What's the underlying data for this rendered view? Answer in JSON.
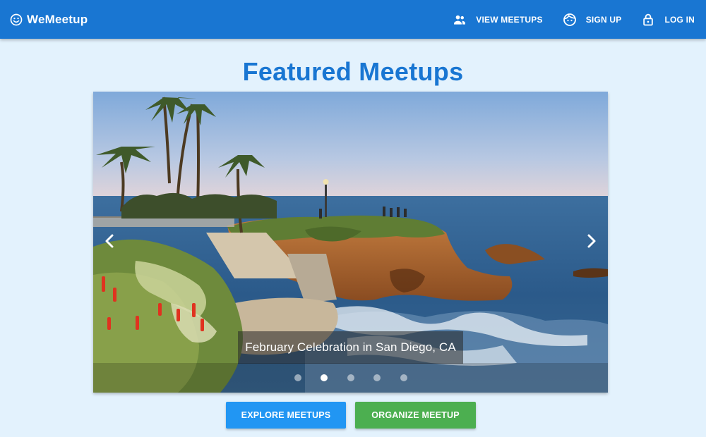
{
  "app": {
    "brand": "WeMeetup"
  },
  "nav": {
    "items": [
      {
        "label": "VIEW MEETUPS",
        "icon": "people-icon"
      },
      {
        "label": "SIGN UP",
        "icon": "face-icon"
      },
      {
        "label": "LOG IN",
        "icon": "lock-icon"
      }
    ]
  },
  "page": {
    "title": "Featured Meetups"
  },
  "carousel": {
    "caption": "February Celebration in San Diego, CA",
    "slide_count": 5,
    "active_slide": 2,
    "prev_icon": "chevron-left-icon",
    "next_icon": "chevron-right-icon"
  },
  "actions": {
    "explore_label": "EXPLORE MEETUPS",
    "organize_label": "ORGANIZE MEETUP"
  },
  "colors": {
    "primary": "#1976d2",
    "background": "#e3f2fd",
    "explore": "#2196f3",
    "organize": "#4caf50"
  }
}
